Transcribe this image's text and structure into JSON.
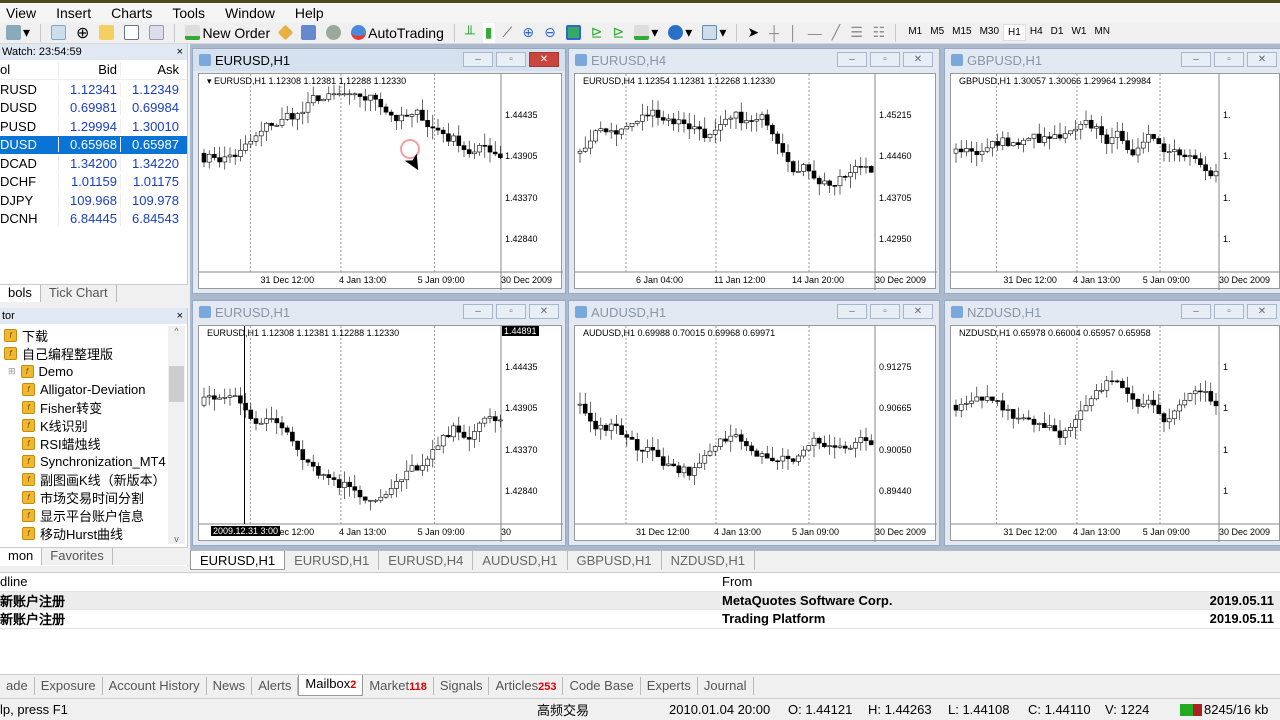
{
  "menu": [
    "View",
    "Insert",
    "Charts",
    "Tools",
    "Window",
    "Help"
  ],
  "toolbar": {
    "new_order": "New Order",
    "autotrading": "AutoTrading",
    "timeframes": [
      "M1",
      "M5",
      "M15",
      "M30",
      "H1",
      "H4",
      "D1",
      "W1",
      "MN"
    ],
    "active_timeframe": "H1"
  },
  "market_watch": {
    "title": "Watch: 23:54:59",
    "close": "×",
    "columns": [
      "ol",
      "Bid",
      "Ask"
    ],
    "rows": [
      [
        "RUSD",
        "1.12341",
        "1.12349"
      ],
      [
        "DUSD",
        "0.69981",
        "0.69984"
      ],
      [
        "PUSD",
        "1.29994",
        "1.30010"
      ],
      [
        "DUSD",
        "0.65968",
        "0.65987"
      ],
      [
        "DCAD",
        "1.34200",
        "1.34220"
      ],
      [
        "DCHF",
        "1.01159",
        "1.01175"
      ],
      [
        "DJPY",
        "109.968",
        "109.978"
      ],
      [
        "DCNH",
        "6.84445",
        "6.84543"
      ]
    ],
    "selected_row": 3,
    "tabs": [
      "bols",
      "Tick Chart"
    ]
  },
  "navigator": {
    "title": "tor",
    "close": "×",
    "items": [
      {
        "label": "下载",
        "level": 0
      },
      {
        "label": "自己编程整理版",
        "level": 0
      },
      {
        "label": "Demo",
        "level": 1,
        "expand": "⊞"
      },
      {
        "label": "Alligator-Deviation",
        "level": 1
      },
      {
        "label": "Fisher转变",
        "level": 1
      },
      {
        "label": "K线识别",
        "level": 1
      },
      {
        "label": "RSI蜡烛线",
        "level": 1
      },
      {
        "label": "Synchronization_MT4",
        "level": 1
      },
      {
        "label": "副图画K线（新版本）",
        "level": 1
      },
      {
        "label": "市场交易时间分割",
        "level": 1
      },
      {
        "label": "显示平台账户信息",
        "level": 1
      },
      {
        "label": "移动Hurst曲线",
        "level": 1
      }
    ],
    "tabs": [
      "mon",
      "Favorites"
    ]
  },
  "charts": [
    {
      "title": "EURUSD,H1",
      "info": "▾ EURUSD,H1  1.12308 1.12381 1.12288 1.12330",
      "prices": [
        "1.44435",
        "1.43905",
        "1.43370",
        "1.42840"
      ],
      "times": [
        "30 Dec 2009",
        "31 Dec 12:00",
        "4 Jan 13:00",
        "5 Jan 09:00"
      ],
      "active": true
    },
    {
      "title": "EURUSD,H4",
      "info": "EURUSD,H4  1.12354 1.12381 1.12268 1.12330",
      "prices": [
        "1.45215",
        "1.44460",
        "1.43705",
        "1.42950"
      ],
      "times": [
        "30 Dec 2009",
        "6 Jan 04:00",
        "11 Jan 12:00",
        "14 Jan 20:00"
      ]
    },
    {
      "title": "GBPUSD,H1",
      "info": "GBPUSD,H1  1.30057 1.30066 1.29964 1.29984",
      "prices": [
        "1.",
        "1.",
        "1.",
        "1."
      ],
      "times": [
        "30 Dec 2009",
        "31 Dec 12:00",
        "4 Jan 13:00",
        "5 Jan 09:00"
      ]
    },
    {
      "title": "EURUSD,H1",
      "info": "EURUSD,H1  1.12308 1.12381 1.12288 1.12330",
      "prices": [
        "1.44435",
        "1.43905",
        "1.43370",
        "1.42840"
      ],
      "times": [
        "30",
        "31 Dec 12:00",
        "4 Jan 13:00",
        "5 Jan 09:00"
      ],
      "crosshair_price": "1.44891",
      "crosshair_time": "2009.12.31 3:00"
    },
    {
      "title": "AUDUSD,H1",
      "info": "AUDUSD,H1  0.69988 0.70015 0.69968 0.69971",
      "prices": [
        "0.91275",
        "0.90665",
        "0.90050",
        "0.89440"
      ],
      "times": [
        "30 Dec 2009",
        "31 Dec 12:00",
        "4 Jan 13:00",
        "5 Jan 09:00"
      ]
    },
    {
      "title": "NZDUSD,H1",
      "info": "NZDUSD,H1  0.65978 0.66004 0.65957 0.65958",
      "prices": [
        "1",
        "1",
        "1",
        "1"
      ],
      "times": [
        "30 Dec 2009",
        "31 Dec 12:00",
        "4 Jan 13:00",
        "5 Jan 09:00"
      ]
    }
  ],
  "chart_tabs": [
    "EURUSD,H1",
    "EURUSD,H1",
    "EURUSD,H4",
    "AUDUSD,H1",
    "GBPUSD,H1",
    "NZDUSD,H1"
  ],
  "terminal": {
    "columns": [
      "dline",
      "From",
      ""
    ],
    "rows": [
      [
        "新账户注册",
        "MetaQuotes Software Corp.",
        "2019.05.11"
      ],
      [
        "新账户注册",
        "Trading Platform",
        "2019.05.11"
      ]
    ]
  },
  "bottom_tabs": [
    {
      "label": "ade"
    },
    {
      "label": "Exposure"
    },
    {
      "label": "Account History"
    },
    {
      "label": "News"
    },
    {
      "label": "Alerts"
    },
    {
      "label": "Mailbox",
      "badge": "2",
      "active": true
    },
    {
      "label": "Market",
      "badge": "118"
    },
    {
      "label": "Signals"
    },
    {
      "label": "Articles",
      "badge": "253"
    },
    {
      "label": "Code Base"
    },
    {
      "label": "Experts"
    },
    {
      "label": "Journal"
    }
  ],
  "status": {
    "help": "lp, press F1",
    "profile": "高频交易",
    "time": "2010.01.04 20:00",
    "open": "O: 1.44121",
    "high": "H: 1.44263",
    "low": "L: 1.44108",
    "close": "C: 1.44110",
    "volume": "V: 1224",
    "traffic": "8245/16 kb"
  }
}
